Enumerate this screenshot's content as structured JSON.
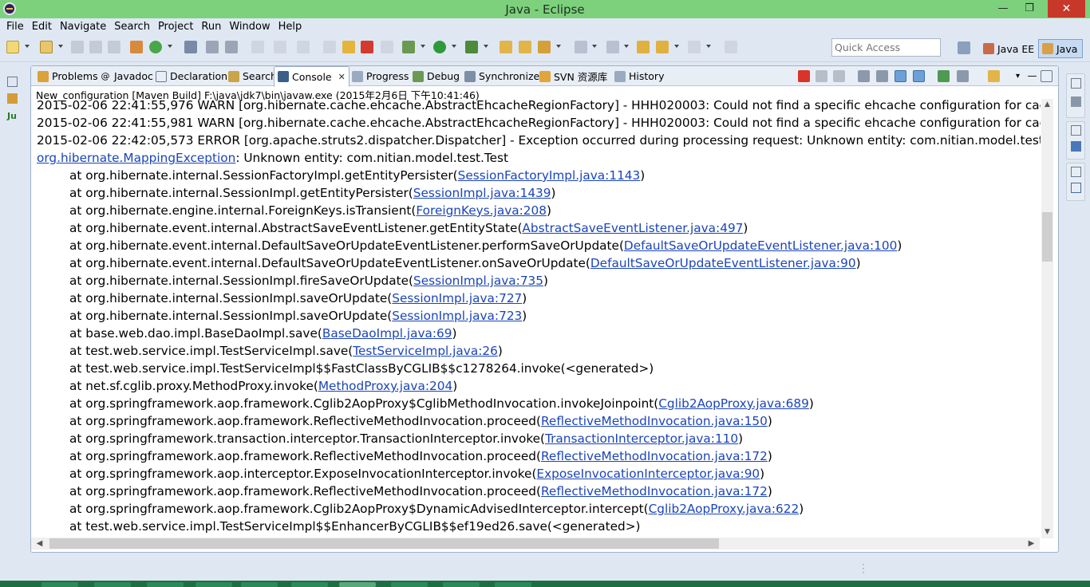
{
  "window": {
    "title": "Java - Eclipse",
    "min_glyph": "—",
    "max_glyph": "❐",
    "close_glyph": "✕"
  },
  "menu": [
    "File",
    "Edit",
    "Navigate",
    "Search",
    "Project",
    "Run",
    "Window",
    "Help"
  ],
  "quick_access": {
    "placeholder": "Quick Access"
  },
  "perspectives": [
    {
      "label": "Java EE",
      "icon": "java-ee-perspective-icon"
    },
    {
      "label": "Java",
      "icon": "java-perspective-icon",
      "active": true
    }
  ],
  "tabs": [
    {
      "label": "Problems",
      "icon": "problems-icon"
    },
    {
      "label": "Javadoc",
      "icon": "javadoc-icon",
      "glyph": "@"
    },
    {
      "label": "Declaration",
      "icon": "declaration-icon"
    },
    {
      "label": "Search",
      "icon": "search-icon"
    },
    {
      "label": "Console",
      "icon": "console-icon",
      "active": true
    },
    {
      "label": "Progress",
      "icon": "progress-icon"
    },
    {
      "label": "Debug",
      "icon": "debug-icon"
    },
    {
      "label": "Synchronize",
      "icon": "synchronize-icon"
    },
    {
      "label": "SVN 资源库",
      "icon": "svn-repository-icon"
    },
    {
      "label": "History",
      "icon": "history-icon"
    }
  ],
  "console": {
    "header": "New_configuration [Maven Build] F:\\java\\jdk7\\bin\\javaw.exe (2015年2月6日 下午10:41:46)",
    "lines": [
      {
        "text": "2015-02-06 22:41:55,976 WARN [org.hibernate.cache.ehcache.AbstractEhcacheRegionFactory] - HHH020003: Could not find a specific ehcache configuration for cach",
        "indent": false
      },
      {
        "text": "2015-02-06 22:41:55,981 WARN [org.hibernate.cache.ehcache.AbstractEhcacheRegionFactory] - HHH020003: Could not find a specific ehcache configuration for cach",
        "indent": false
      },
      {
        "text": "2015-02-06 22:42:05,573 ERROR [org.apache.struts2.dispatcher.Dispatcher] - Exception occurred during processing request: Unknown entity: com.nitian.model.test.Te",
        "indent": false
      },
      {
        "pre": "",
        "link": "org.hibernate.MappingException",
        "post": ": Unknown entity: com.nitian.model.test.Test",
        "indent": false
      },
      {
        "pre": "at org.hibernate.internal.SessionFactoryImpl.getEntityPersister(",
        "link": "SessionFactoryImpl.java:1143",
        "post": ")",
        "indent": true
      },
      {
        "pre": "at org.hibernate.internal.SessionImpl.getEntityPersister(",
        "link": "SessionImpl.java:1439",
        "post": ")",
        "indent": true
      },
      {
        "pre": "at org.hibernate.engine.internal.ForeignKeys.isTransient(",
        "link": "ForeignKeys.java:208",
        "post": ")",
        "indent": true
      },
      {
        "pre": "at org.hibernate.event.internal.AbstractSaveEventListener.getEntityState(",
        "link": "AbstractSaveEventListener.java:497",
        "post": ")",
        "indent": true
      },
      {
        "pre": "at org.hibernate.event.internal.DefaultSaveOrUpdateEventListener.performSaveOrUpdate(",
        "link": "DefaultSaveOrUpdateEventListener.java:100",
        "post": ")",
        "indent": true
      },
      {
        "pre": "at org.hibernate.event.internal.DefaultSaveOrUpdateEventListener.onSaveOrUpdate(",
        "link": "DefaultSaveOrUpdateEventListener.java:90",
        "post": ")",
        "indent": true
      },
      {
        "pre": "at org.hibernate.internal.SessionImpl.fireSaveOrUpdate(",
        "link": "SessionImpl.java:735",
        "post": ")",
        "indent": true
      },
      {
        "pre": "at org.hibernate.internal.SessionImpl.saveOrUpdate(",
        "link": "SessionImpl.java:727",
        "post": ")",
        "indent": true
      },
      {
        "pre": "at org.hibernate.internal.SessionImpl.saveOrUpdate(",
        "link": "SessionImpl.java:723",
        "post": ")",
        "indent": true
      },
      {
        "pre": "at base.web.dao.impl.BaseDaoImpl.save(",
        "link": "BaseDaoImpl.java:69",
        "post": ")",
        "indent": true
      },
      {
        "pre": "at test.web.service.impl.TestServiceImpl.save(",
        "link": "TestServiceImpl.java:26",
        "post": ")",
        "indent": true
      },
      {
        "text": "at test.web.service.impl.TestServiceImpl$$FastClassByCGLIB$$c1278264.invoke(<generated>)",
        "indent": true
      },
      {
        "pre": "at net.sf.cglib.proxy.MethodProxy.invoke(",
        "link": "MethodProxy.java:204",
        "post": ")",
        "indent": true
      },
      {
        "pre": "at org.springframework.aop.framework.Cglib2AopProxy$CglibMethodInvocation.invokeJoinpoint(",
        "link": "Cglib2AopProxy.java:689",
        "post": ")",
        "indent": true
      },
      {
        "pre": "at org.springframework.aop.framework.ReflectiveMethodInvocation.proceed(",
        "link": "ReflectiveMethodInvocation.java:150",
        "post": ")",
        "indent": true
      },
      {
        "pre": "at org.springframework.transaction.interceptor.TransactionInterceptor.invoke(",
        "link": "TransactionInterceptor.java:110",
        "post": ")",
        "indent": true
      },
      {
        "pre": "at org.springframework.aop.framework.ReflectiveMethodInvocation.proceed(",
        "link": "ReflectiveMethodInvocation.java:172",
        "post": ")",
        "indent": true
      },
      {
        "pre": "at org.springframework.aop.interceptor.ExposeInvocationInterceptor.invoke(",
        "link": "ExposeInvocationInterceptor.java:90",
        "post": ")",
        "indent": true
      },
      {
        "pre": "at org.springframework.aop.framework.ReflectiveMethodInvocation.proceed(",
        "link": "ReflectiveMethodInvocation.java:172",
        "post": ")",
        "indent": true
      },
      {
        "pre": "at org.springframework.aop.framework.Cglib2AopProxy$DynamicAdvisedInterceptor.intercept(",
        "link": "Cglib2AopProxy.java:622",
        "post": ")",
        "indent": true
      },
      {
        "text": "at test.web.service.impl.TestServiceImpl$$EnhancerByCGLIB$$ef19ed26.save(<generated>)",
        "indent": true
      }
    ]
  },
  "colors": {
    "title_bar": "#7dd17d",
    "chrome": "#dfe8f2",
    "link": "#1b45b9",
    "close_button": "#c7382b",
    "taskbar": "#1f6e43"
  }
}
